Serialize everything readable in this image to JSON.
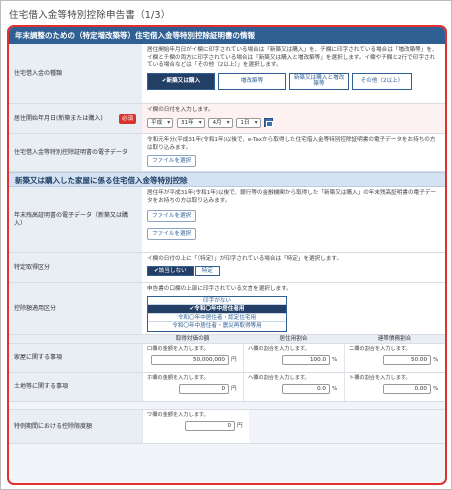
{
  "page_title": "住宅借入金等特別控除申告書（1/3）",
  "panel_title": "年末調整のための（特定増改築等）住宅借入金等特別控除証明書の情報",
  "house_type": {
    "label": "住宅借入金の種類",
    "hint": "居住開始年月日がイ欄に印字されている場合は「新築又は購入」を、チ欄に印字されている場合は「増改築等」を、イ欄とチ欄の両方に印字されている場合は「新築又は購入と増改築等」を選択します。イ欄やチ欄と2行で印字されている場合などは「その他（2以上）」を選択します。",
    "options": [
      "✔新築又は購入",
      "増改築等",
      "新築又は購入と増改築等",
      "その他（2以上）"
    ],
    "selected_index": 0
  },
  "move_in": {
    "label": "居住開始年月日(新築または購入)",
    "required": "必須",
    "hint": "イ欄の日付を入力します。",
    "era": "平成",
    "year": "31年",
    "month": "4月",
    "day": "1日"
  },
  "cert_data": {
    "label": "住宅借入金等特別控除証明書の電子データ",
    "hint": "令和元年分(平成31年(令和1年)以後で、e-Taxから取得した住宅借入金等特別控除証明書の電子データをお持ちの方は取り込みます。",
    "button": "ファイルを選択"
  },
  "section2_title": "新築又は購入した家屋に係る住宅借入金等特別控除",
  "balance_cert": {
    "label": "年末残高証明書の電子データ（新築又は購入）",
    "hint": "居住年が平成31年(令和1年)以後で、銀行等の金融機関から取得した「新築又は購入」の年末残高証明書の電子データをお持ちの方は取り込みます。",
    "button1": "ファイルを選択",
    "button2": "ファイルを選択"
  },
  "special_acq": {
    "label": "特定取得区分",
    "hint": "イ欄の日付の上に「（特定）」が印字されている場合は「特定」を選択します。",
    "options": [
      "✔該当しない",
      "特定"
    ],
    "selected_index": 0
  },
  "deduction_class": {
    "label": "控除額適用区分",
    "hint": "申告書の口欄の上部に印字されている文言を選択します。",
    "options": [
      "印字がない",
      "✔令和〇年中居住者用",
      "令和〇年中居住者・認定住宅用",
      "令和〇年中居住者・震災再取得等用"
    ],
    "selected_index": 1
  },
  "grid": {
    "headers": [
      "取得対価の額",
      "居住用割合",
      "連帯債務割合"
    ],
    "house": {
      "label": "家屋に関する事項",
      "hints": [
        "口欄の金額を入力します。",
        "ハ欄の割合を入力します。",
        "二欄の割合を入力します。"
      ],
      "values": [
        "50,000,000",
        "100.0",
        "50.00"
      ],
      "units": [
        "円",
        "%",
        "%"
      ]
    },
    "land": {
      "label": "土地等に関する事項",
      "hints": [
        "ホ欄の金額を入力します。",
        "ヘ欄の割合を入力します。",
        "ト欄の割合を入力します。"
      ],
      "values": [
        "0",
        "0.0",
        "0.00"
      ],
      "units": [
        "円",
        "%",
        "%"
      ]
    }
  },
  "limit": {
    "label": "特例期間における控除限度額",
    "hint": "ワ欄の金額を入力します。",
    "value": "0",
    "unit": "円"
  },
  "colors": {
    "header": "#2f5f93",
    "selected": "#243f66",
    "frame": "#e03030",
    "required": "#d9342b"
  }
}
